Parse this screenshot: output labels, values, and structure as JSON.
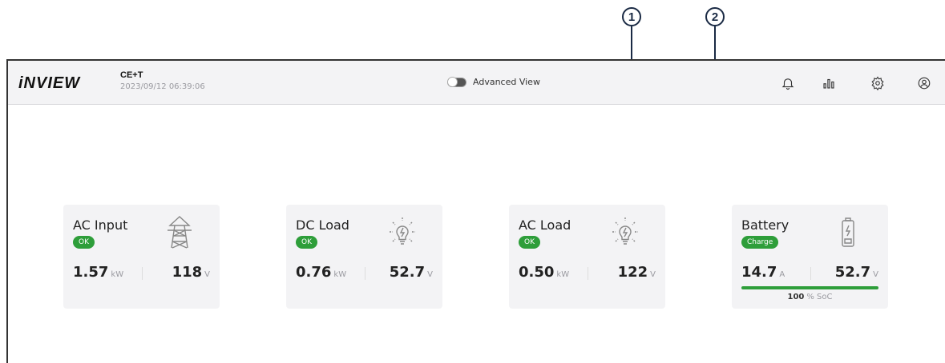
{
  "callouts": [
    "1",
    "2"
  ],
  "header": {
    "logo": "iNVIEW",
    "site_name": "CE+T",
    "timestamp": "2023/09/12 06:39:06",
    "advanced_view_label": "Advanced View",
    "advanced_view_on": false,
    "icons": [
      "bell-icon",
      "bar-chart-icon",
      "gear-icon",
      "user-icon"
    ]
  },
  "cards": [
    {
      "title": "AC Input",
      "status": "OK",
      "icon": "pylon-icon",
      "left_value": "1.57",
      "left_unit": "kW",
      "right_value": "118",
      "right_unit": "V"
    },
    {
      "title": "DC Load",
      "status": "OK",
      "icon": "bulb-icon",
      "left_value": "0.76",
      "left_unit": "kW",
      "right_value": "52.7",
      "right_unit": "V"
    },
    {
      "title": "AC Load",
      "status": "OK",
      "icon": "bulb-icon",
      "left_value": "0.50",
      "left_unit": "kW",
      "right_value": "122",
      "right_unit": "V"
    },
    {
      "title": "Battery",
      "status": "Charge",
      "icon": "battery-icon",
      "left_value": "14.7",
      "left_unit": "A",
      "right_value": "52.7",
      "right_unit": "V",
      "soc_value": "100",
      "soc_unit": "% SoC",
      "soc_fraction": 1.0
    }
  ],
  "colors": {
    "ok_green": "#2e9e3a",
    "header_bg": "#f3f3f5",
    "card_bg": "#f3f3f5"
  }
}
